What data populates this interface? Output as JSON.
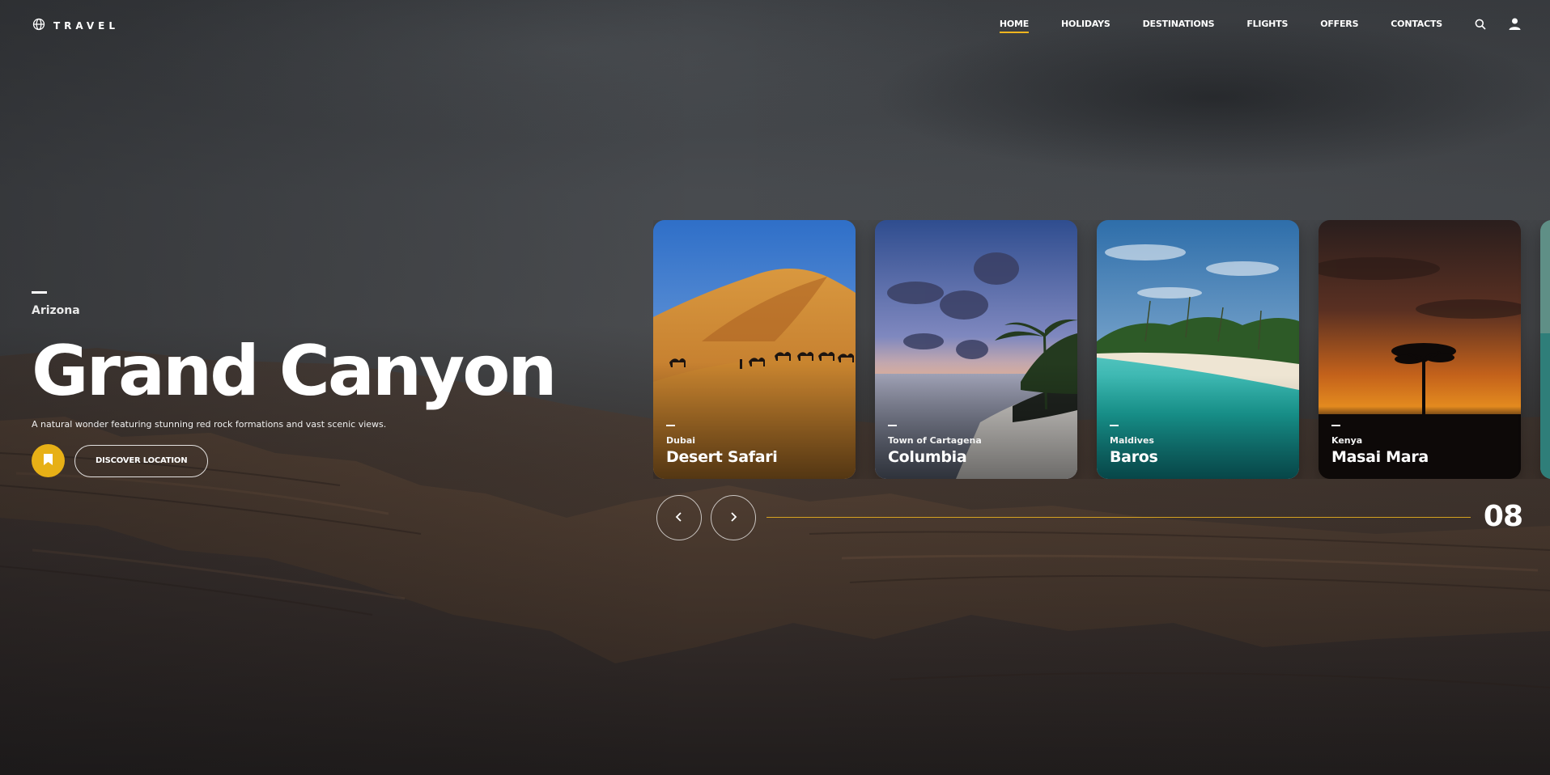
{
  "brand": {
    "logo_text": "TRAVEL",
    "logo_icon": "globe-icon"
  },
  "nav": {
    "items": [
      {
        "label": "HOME",
        "active": true
      },
      {
        "label": "HOLIDAYS",
        "active": false
      },
      {
        "label": "DESTINATIONS",
        "active": false
      },
      {
        "label": "FLIGHTS",
        "active": false
      },
      {
        "label": "OFFERS",
        "active": false
      },
      {
        "label": "CONTACTS",
        "active": false
      }
    ],
    "icons": [
      "search-icon",
      "user-icon"
    ]
  },
  "hero": {
    "location": "Arizona",
    "title": "Grand Canyon",
    "description": "A natural wonder featuring stunning red rock formations and vast scenic views.",
    "bookmark_icon": "bookmark-icon",
    "cta_label": "DISCOVER LOCATION"
  },
  "cards": [
    {
      "place": "Dubai",
      "title": "Desert Safari"
    },
    {
      "place": "Town of Cartagena",
      "title": "Columbia"
    },
    {
      "place": "Maldives",
      "title": "Baros"
    },
    {
      "place": "Kenya",
      "title": "Masai Mara"
    }
  ],
  "slider": {
    "prev_icon": "chevron-left-icon",
    "next_icon": "chevron-right-icon",
    "slide_number": "08"
  },
  "colors": {
    "accent": "#f0b51f",
    "bookmark": "#e7b016"
  }
}
